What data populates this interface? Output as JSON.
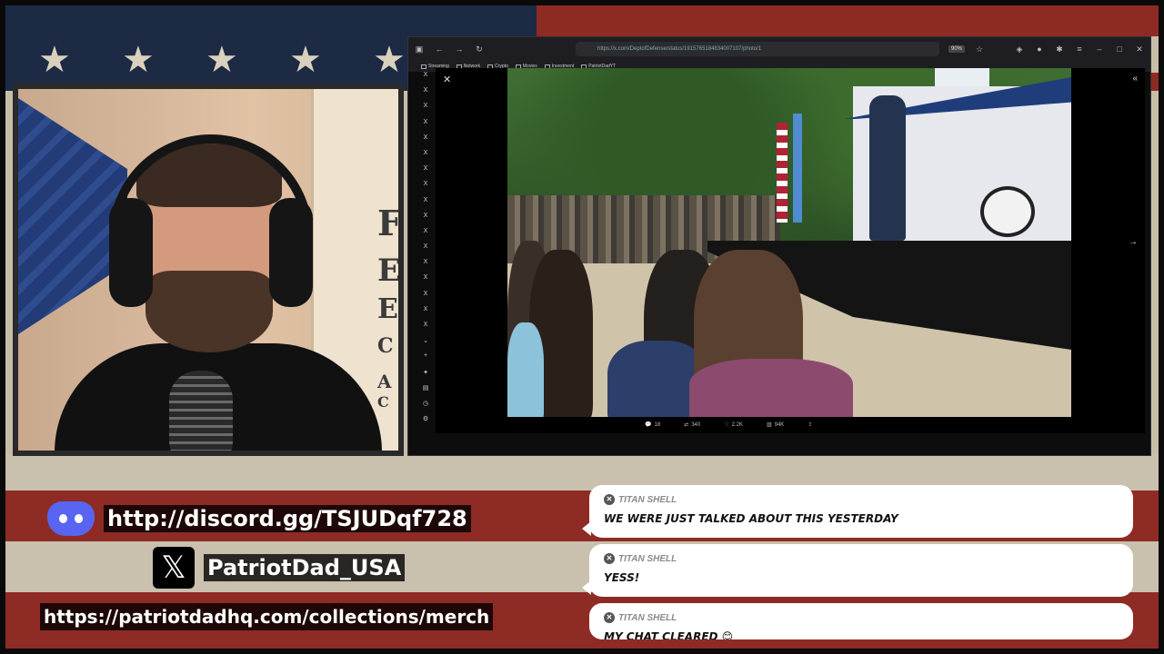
{
  "overlay": {
    "discord_link": "http://discord.gg/TSJUDqf728",
    "x_handle": "PatriotDad_USA",
    "merch_link": "https://patriotdadhq.com/collections/merch"
  },
  "browser": {
    "url": "https://x.com/DeptofDefense/status/1915765184834007107/photo/1",
    "zoom": "90%",
    "bookmarks": [
      "Streaming",
      "Network",
      "Crypto",
      "Movies",
      "Investment",
      "PatriotDadYT"
    ],
    "tweet_actions": {
      "replies": "18",
      "reposts": "340",
      "likes": "2.2K",
      "views": "94K"
    }
  },
  "chat": [
    {
      "user": "TITAN SHELL",
      "message": "WE WERE JUST TALKED ABOUT THIS YESTERDAY"
    },
    {
      "user": "TITAN SHELL",
      "message": "YESS!"
    },
    {
      "user": "TITAN SHELL",
      "message": "MY CHAT CLEARED 😊"
    }
  ],
  "poster_letters": [
    "F",
    "E",
    "E",
    "C",
    "A",
    "C"
  ]
}
